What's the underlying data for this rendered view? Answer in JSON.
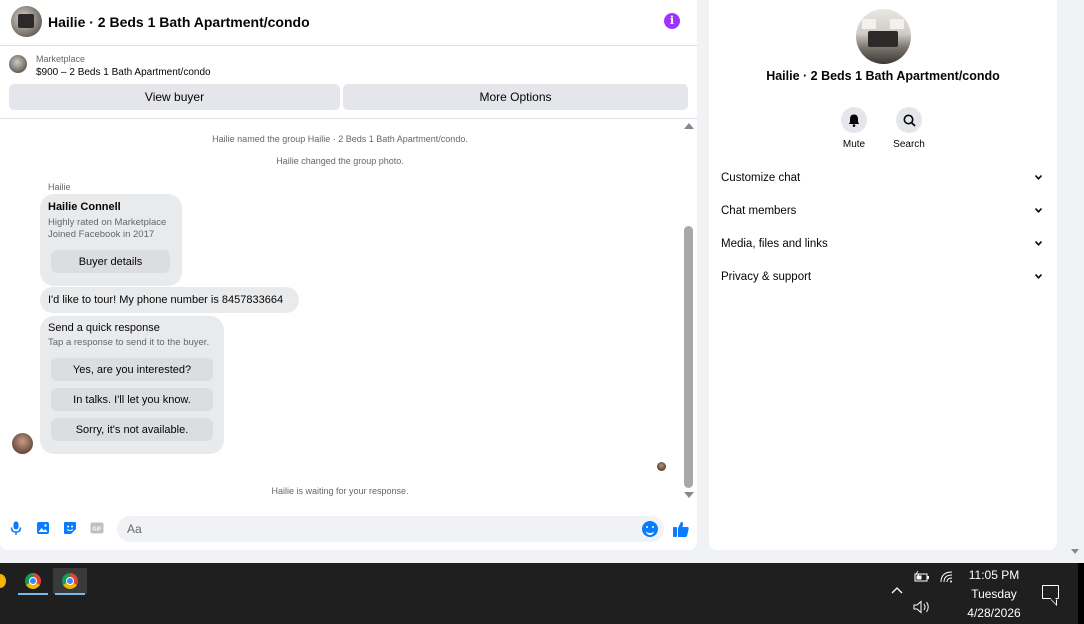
{
  "header": {
    "title": "Hailie · 2 Beds 1 Bath Apartment/condo"
  },
  "listing": {
    "source": "Marketplace",
    "price_title": "$900 – 2 Beds 1 Bath Apartment/condo",
    "view_buyer_label": "View buyer",
    "more_options_label": "More Options"
  },
  "messages": {
    "system": [
      "Hailie named the group Hailie · 2 Beds 1 Bath Apartment/condo.",
      "Hailie changed the group photo."
    ],
    "sender": "Hailie",
    "buyer_card": {
      "name": "Hailie Connell",
      "line1": "Highly rated on Marketplace",
      "line2": "Joined Facebook in 2017",
      "button": "Buyer details"
    },
    "phone_message": "I'd like to tour! My phone number is 8457833664",
    "quick_response": {
      "title": "Send a quick response",
      "subtitle": "Tap a response to send it to the buyer.",
      "options": [
        "Yes, are you interested?",
        "In talks. I'll let you know.",
        "Sorry, it's not available."
      ]
    },
    "waiting": "Hailie is waiting for your response."
  },
  "composer": {
    "placeholder": "Aa"
  },
  "details": {
    "title": "Hailie · 2 Beds 1 Bath Apartment/condo",
    "actions": [
      {
        "label": "Mute",
        "icon": "bell-icon"
      },
      {
        "label": "Search",
        "icon": "search-icon"
      }
    ],
    "sections": [
      "Customize chat",
      "Chat members",
      "Media, files and links",
      "Privacy & support"
    ]
  },
  "taskbar": {
    "time": "11:05 PM",
    "day": "Tuesday",
    "date": "4/28/2026"
  },
  "colors": {
    "accent_blue": "#0a7cff",
    "info_purple": "#a033ff",
    "bubble_grey": "#e9eaec",
    "taskbar": "#1f1f1f"
  }
}
